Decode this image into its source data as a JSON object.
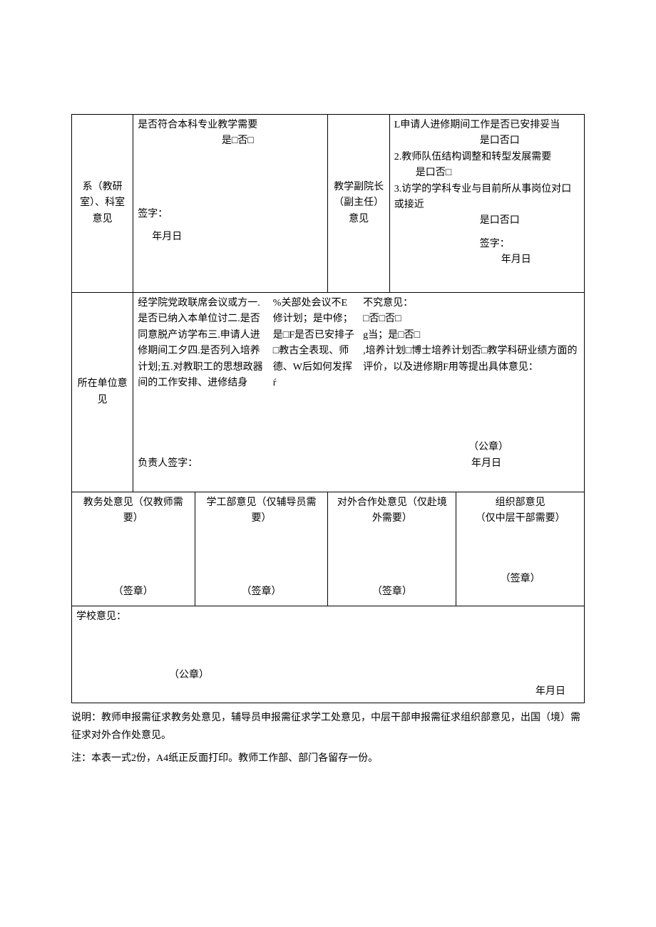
{
  "row1": {
    "label1": "系（教研室）、科室意见",
    "content1_line1": "是否符合本科专业教学需要",
    "content1_line2": "是□否□",
    "content1_sign": "签字：",
    "content1_date": "年月日",
    "label2": "教学副院长（副主任）意见",
    "content2_l1": "L申请人进修期间工作是否已安排妥当",
    "content2_l2": "是口否口",
    "content2_l3": "2.教师队伍结构调整和转型发展需要",
    "content2_l4": "是口否□",
    "content2_l5": "3.访学的学科专业与目前所从事岗位对口或接近",
    "content2_l6": "是口否口",
    "content2_sign": "签字：",
    "content2_date": "年月日"
  },
  "row2": {
    "label": "所在单位意见",
    "col1": "经学院党政联席会议或方一.是否已纳入本单位讨二.是否同意脱产访学布三.申请人进修期间工夕四.是否列入培养计划;五.对教职工的思想政器间的工作安排、进修结身",
    "col2": "%关部处会议不E修计划；是中修；是□F是否已安排子□教古全表现、师德、W后如何发挥ŕ",
    "col3": "不究意见：\n□否□否□\ng当；是□否□\n,培养计划□博士培养计划否□教学科研业绩方面的评价，以及进修期F用等提出具体意见：",
    "sign": "负责人签字：",
    "seal": "（公章）",
    "date": "年月日"
  },
  "row3": {
    "h1": "教务处意见（仅教师需要）",
    "h2": "学工部意见（仅辅导员需要）",
    "h3": "对外合作处意见（仅赴境外需要）",
    "h4": "组织部意见\n（仅中层干部需要）",
    "seal": "（签章）"
  },
  "row4": {
    "label": "学校意见：",
    "seal": "（公章）",
    "date": "年月日"
  },
  "footer": "说明：教师申报需征求教务处意见，辅导员申报需征求学工处意见，中层干部申报需征求组织部意见，出国（境）需征求对外合作处意见。",
  "note": "注：本表一式2份，A4纸正反面打印。教师工作部、部门各留存一份。"
}
